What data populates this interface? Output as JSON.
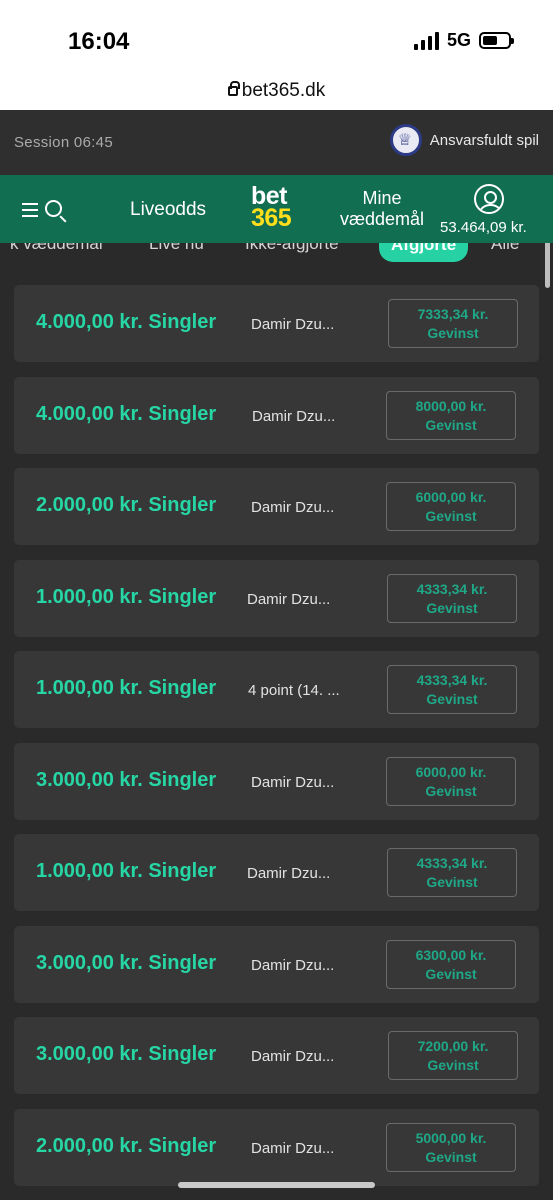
{
  "status_bar": {
    "time": "16:04",
    "network": "5G",
    "url": "bet365.dk"
  },
  "session": {
    "label": "Session 06:45",
    "responsible": "Ansvarsfuldt spil"
  },
  "nav": {
    "liveodds": "Liveodds",
    "logo_top": "bet",
    "logo_bottom": "365",
    "mine_line1": "Mine",
    "mine_line2": "væddemål",
    "balance": "53.464,09 kr."
  },
  "tabs": [
    {
      "label": "k væddemål",
      "active": false
    },
    {
      "label": "Live nu",
      "active": false
    },
    {
      "label": "Ikke-afgjorte",
      "active": false
    },
    {
      "label": "Afgjorte",
      "active": true
    },
    {
      "label": "Alle",
      "active": false
    }
  ],
  "bets": [
    {
      "title": "4.000,00 kr. Singler",
      "desc": "Damir Dzu...",
      "winnings": "7333,34 kr.",
      "win_label": "Gevinst"
    },
    {
      "title": "4.000,00 kr. Singler",
      "desc": "Damir Dzu...",
      "winnings": "8000,00 kr.",
      "win_label": "Gevinst"
    },
    {
      "title": "2.000,00 kr. Singler",
      "desc": "Damir Dzu...",
      "winnings": "6000,00 kr.",
      "win_label": "Gevinst"
    },
    {
      "title": "1.000,00 kr. Singler",
      "desc": "Damir Dzu...",
      "winnings": "4333,34 kr.",
      "win_label": "Gevinst"
    },
    {
      "title": "1.000,00 kr. Singler",
      "desc": "4 point (14. ...",
      "winnings": "4333,34 kr.",
      "win_label": "Gevinst"
    },
    {
      "title": "3.000,00 kr. Singler",
      "desc": "Damir Dzu...",
      "winnings": "6000,00 kr.",
      "win_label": "Gevinst"
    },
    {
      "title": "1.000,00 kr. Singler",
      "desc": "Damir Dzu...",
      "winnings": "4333,34 kr.",
      "win_label": "Gevinst"
    },
    {
      "title": "3.000,00 kr. Singler",
      "desc": "Damir Dzu...",
      "winnings": "6300,00 kr.",
      "win_label": "Gevinst"
    },
    {
      "title": "3.000,00 kr. Singler",
      "desc": "Damir Dzu...",
      "winnings": "7200,00 kr.",
      "win_label": "Gevinst"
    },
    {
      "title": "2.000,00 kr. Singler",
      "desc": "Damir Dzu...",
      "winnings": "5000,00 kr.",
      "win_label": "Gevinst"
    }
  ],
  "colors": {
    "header_green": "#126e51",
    "accent_green": "#26d6a5",
    "logo_yellow": "#ffdf1b",
    "card_bg": "#373737",
    "page_bg": "#2a2a2a"
  }
}
